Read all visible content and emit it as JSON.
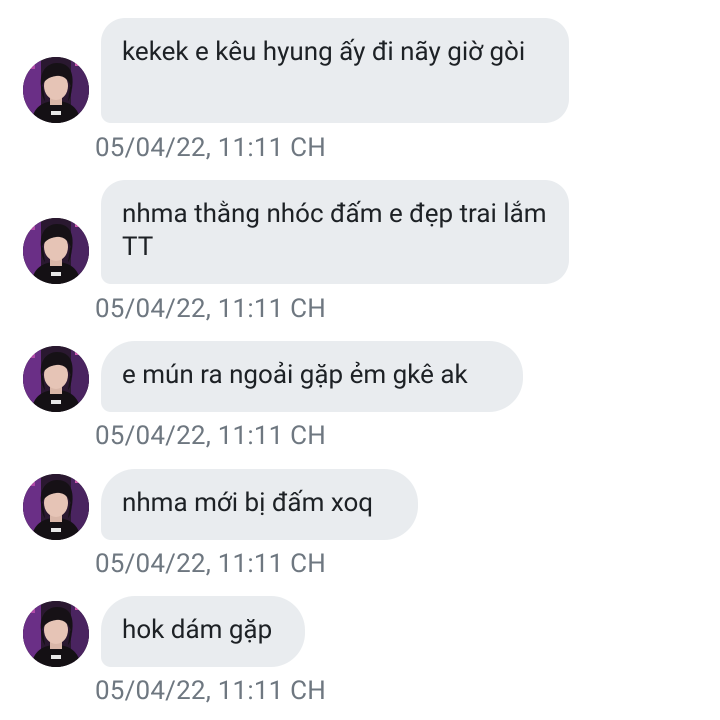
{
  "conversation": {
    "messages": [
      {
        "text": "kekek e kêu hyung ấy đi nãy giờ gòi",
        "timestamp": "05/04/22, 11:11 CH"
      },
      {
        "text": "nhma thằng nhóc đấm e đẹp trai lắm TT",
        "timestamp": "05/04/22, 11:11 CH"
      },
      {
        "text": "e mún ra ngoải gặp ẻm gkê ak",
        "timestamp": "05/04/22, 11:11 CH"
      },
      {
        "text": "nhma mới bị đấm xoq",
        "timestamp": "05/04/22, 11:11 CH"
      },
      {
        "text": "hok dám gặp",
        "timestamp": "05/04/22, 11:11 CH"
      }
    ]
  },
  "colors": {
    "bubble": "#e9ecef",
    "text": "#1d2125",
    "timestamp": "#6e7780",
    "background": "#ffffff"
  },
  "icons": {
    "sender_avatar": "person-avatar-icon"
  }
}
